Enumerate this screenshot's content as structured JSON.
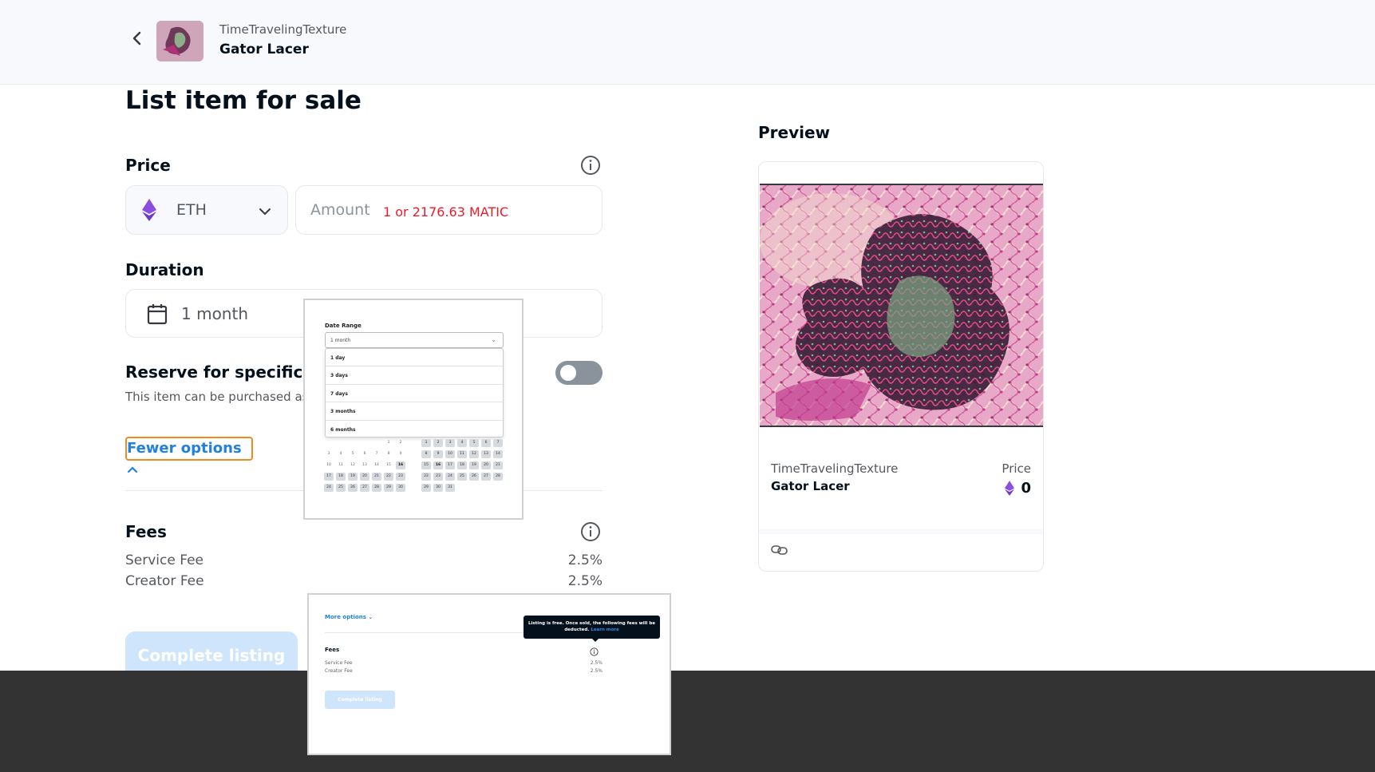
{
  "header": {
    "collection": "TimeTravelingTexture",
    "item": "Gator Lacer"
  },
  "form": {
    "title": "List item for sale",
    "price": {
      "label": "Price",
      "currency": "ETH",
      "amount_placeholder": "Amount",
      "error": "1 or 2176.63 MATIC"
    },
    "duration": {
      "label": "Duration",
      "value": "1 month"
    },
    "reserve": {
      "title": "Reserve for specific bu",
      "subtitle": "This item can be purchased as",
      "enabled": false
    },
    "fewer_options": "Fewer options",
    "fees": {
      "label": "Fees",
      "rows": [
        {
          "name": "Service Fee",
          "value": "2.5%"
        },
        {
          "name": "Creator Fee",
          "value": "2.5%"
        }
      ]
    },
    "complete_button": "Complete listing"
  },
  "preview": {
    "title": "Preview",
    "collection": "TimeTravelingTexture",
    "item": "Gator Lacer",
    "price_label": "Price",
    "price_value": "0"
  },
  "calendar_popup": {
    "label": "Date Range",
    "selected": "1 month",
    "options": [
      "1 day",
      "3 days",
      "7 days",
      "3 months",
      "6 months"
    ],
    "month_a": [
      "1",
      "2",
      "3",
      "4",
      "5",
      "6",
      "7",
      "8",
      "9",
      "10",
      "11",
      "12",
      "13",
      "14",
      "15",
      "16",
      "17",
      "18",
      "19",
      "20",
      "21",
      "22",
      "23",
      "24",
      "25",
      "26",
      "27",
      "28",
      "29",
      "30"
    ],
    "month_b": [
      "1",
      "2",
      "3",
      "4",
      "5",
      "6",
      "7",
      "8",
      "9",
      "10",
      "11",
      "12",
      "13",
      "14",
      "15",
      "16",
      "17",
      "18",
      "19",
      "20",
      "21",
      "22",
      "23",
      "24",
      "25",
      "26",
      "27",
      "28",
      "29",
      "30",
      "31"
    ]
  },
  "fees_popup": {
    "more_options": "More options",
    "tooltip": "Listing is free. Once sold, the following fees will be deducted.",
    "learn_more": "Learn more",
    "fees_label": "Fees",
    "rows": [
      {
        "name": "Service Fee",
        "value": "2.5%"
      },
      {
        "name": "Creator Fee",
        "value": "2.5%"
      }
    ],
    "button": "Complete listing"
  },
  "colors": {
    "accent": "#2081e2",
    "error": "#eb1c29",
    "focus_ring": "#f08c1f",
    "eth_purple": "#8c4ee0"
  }
}
